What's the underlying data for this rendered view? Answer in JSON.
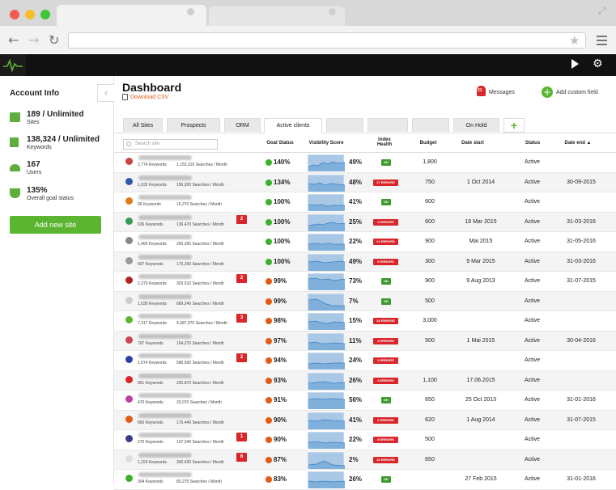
{
  "colors": {
    "accent_green": "#5cb531",
    "error_red": "#d8262a",
    "link_orange": "#e35b14",
    "ok_green": "#3c9a2c"
  },
  "sidebar": {
    "heading": "Account Info",
    "stats": [
      {
        "icon": "grid-icon",
        "value": "189 / Unlimited",
        "label": "Sites"
      },
      {
        "icon": "list-icon",
        "value": "138,324 / Unlimited",
        "label": "Keywords"
      },
      {
        "icon": "users-icon",
        "value": "167",
        "label": "Users"
      },
      {
        "icon": "trophy-icon",
        "value": "135%",
        "label": "Overall goal status"
      }
    ],
    "add_site_label": "Add new site"
  },
  "header": {
    "title": "Dashboard",
    "download_label": "Download CSV",
    "messages_label": "Messages",
    "messages_count": "21",
    "add_field_label": "Add custom field"
  },
  "tabs": [
    "All Sites",
    "Prospects",
    "ORM",
    "Active clients",
    "",
    "",
    "",
    "On Hold"
  ],
  "active_tab": 3,
  "search": {
    "placeholder": "Search site"
  },
  "columns": {
    "goal": "Goal Status",
    "visibility": "Visibility Score",
    "index": "Index Health",
    "budget": "Budget",
    "date_start": "Date start",
    "status": "Status",
    "date_end": "Date end ▲"
  },
  "rows": [
    {
      "kw": "2,774 Keywords",
      "searches": "1,153,310 Searches / Month",
      "note": "",
      "goal": "140%",
      "goal_color": "#3cb12b",
      "vis": "49%",
      "index": "OK",
      "budget": "1,800",
      "date_start": "",
      "status": "Active",
      "date_end": "",
      "fav": "#c44"
    },
    {
      "kw": "1,032 Keywords",
      "searches": "156,200 Searches / Month",
      "note": "",
      "goal": "134%",
      "goal_color": "#3cb12b",
      "vis": "48%",
      "index": "17 ERRORS",
      "budget": "750",
      "date_start": "1 Oct 2014",
      "status": "Active",
      "date_end": "30-09-2015",
      "fav": "#2d5aa8"
    },
    {
      "kw": "96 Keywords",
      "searches": "15,270 Searches / Month",
      "note": "",
      "goal": "100%",
      "goal_color": "#3cb12b",
      "vis": "41%",
      "index": "OK",
      "budget": "600",
      "date_start": "",
      "status": "Active",
      "date_end": "",
      "fav": "#e07a1a"
    },
    {
      "kw": "636 Keywords",
      "searches": "136,470 Searches / Month",
      "note": "2",
      "goal": "100%",
      "goal_color": "#3cb12b",
      "vis": "25%",
      "index": "3 ERRORS",
      "budget": "600",
      "date_start": "18 Mar 2015",
      "status": "Active",
      "date_end": "31-03-2016",
      "fav": "#3a9a56"
    },
    {
      "kw": "1,466 Keywords",
      "searches": "266,260 Searches / Month",
      "note": "",
      "goal": "100%",
      "goal_color": "#3cb12b",
      "vis": "22%",
      "index": "14 ERRORS",
      "budget": "900",
      "date_start": "Mai 2015",
      "status": "Active",
      "date_end": "31-05-2016",
      "fav": "#888"
    },
    {
      "kw": "607 Keywords",
      "searches": "176,260 Searches / Month",
      "note": "",
      "goal": "100%",
      "goal_color": "#3cb12b",
      "vis": "49%",
      "index": "5 ERRORS",
      "budget": "300",
      "date_start": "9 Mar 2015",
      "status": "Active",
      "date_end": "31-03-2016",
      "fav": "#999"
    },
    {
      "kw": "2,379 Keywords",
      "searches": "303,510 Searches / Month",
      "note": "2",
      "goal": "99%",
      "goal_color": "#e35b14",
      "vis": "73%",
      "index": "OK",
      "budget": "900",
      "date_start": "9 Aug 2013",
      "status": "Active",
      "date_end": "31-07-2015",
      "fav": "#b32222"
    },
    {
      "kw": "1,030 Keywords",
      "searches": "689,240 Searches / Month",
      "note": "",
      "goal": "99%",
      "goal_color": "#e35b14",
      "vis": "7%",
      "index": "OK",
      "budget": "500",
      "date_start": "",
      "status": "Active",
      "date_end": "",
      "fav": "#ccc"
    },
    {
      "kw": "7,317 Keywords",
      "searches": "4,387,070 Searches / Month",
      "note": "3",
      "goal": "98%",
      "goal_color": "#e35b14",
      "vis": "15%",
      "index": "34 ERRORS",
      "budget": "3,000",
      "date_start": "",
      "status": "Active",
      "date_end": "",
      "fav": "#5cb531"
    },
    {
      "kw": "797 Keywords",
      "searches": "164,270 Searches / Month",
      "note": "",
      "goal": "97%",
      "goal_color": "#e35b14",
      "vis": "11%",
      "index": "4 ERRORS",
      "budget": "500",
      "date_start": "1 Mai 2015",
      "status": "Active",
      "date_end": "30-04-2016",
      "fav": "#c45"
    },
    {
      "kw": "1,074 Keywords",
      "searches": "586,500 Searches / Month",
      "note": "2",
      "goal": "94%",
      "goal_color": "#e35b14",
      "vis": "24%",
      "index": "2 ERRORS",
      "budget": "",
      "date_start": "",
      "status": "Active",
      "date_end": "",
      "fav": "#2b3fa8"
    },
    {
      "kw": "891 Keywords",
      "searches": "205,870 Searches / Month",
      "note": "",
      "goal": "93%",
      "goal_color": "#e35b14",
      "vis": "26%",
      "index": "3 ERRORS",
      "budget": "1,100",
      "date_start": "17.06.2015",
      "status": "Active",
      "date_end": "",
      "fav": "#d8262a"
    },
    {
      "kw": "470 Keywords",
      "searches": "20,070 Searches / Month",
      "note": "",
      "goal": "91%",
      "goal_color": "#e35b14",
      "vis": "56%",
      "index": "OK",
      "budget": "650",
      "date_start": "25 Oct 2013",
      "status": "Active",
      "date_end": "31-01-2016",
      "fav": "#c03fa0"
    },
    {
      "kw": "860 Keywords",
      "searches": "176,440 Searches / Month",
      "note": "",
      "goal": "90%",
      "goal_color": "#e35b14",
      "vis": "41%",
      "index": "6 ERRORS",
      "budget": "620",
      "date_start": "1 Aug 2014",
      "status": "Active",
      "date_end": "31-07-2015",
      "fav": "#e35b14"
    },
    {
      "kw": "270 Keywords",
      "searches": "107,240 Searches / Month",
      "note": "1",
      "goal": "90%",
      "goal_color": "#e35b14",
      "vis": "22%",
      "index": "5 ERRORS",
      "budget": "500",
      "date_start": "",
      "status": "Active",
      "date_end": "",
      "fav": "#3a3a8a"
    },
    {
      "kw": "1,153 Keywords",
      "searches": "342,430 Searches / Month",
      "note": "6",
      "goal": "87%",
      "goal_color": "#e35b14",
      "vis": "2%",
      "index": "12 ERRORS",
      "budget": "650",
      "date_start": "",
      "status": "Active",
      "date_end": "",
      "fav": "#ddd"
    },
    {
      "kw": "304 Keywords",
      "searches": "80,270 Searches / Month",
      "note": "",
      "goal": "83%",
      "goal_color": "#e35b14",
      "vis": "26%",
      "index": "OK",
      "budget": "",
      "date_start": "27 Feb 2015",
      "status": "Active",
      "date_end": "31-01-2016",
      "fav": "#3cb12b"
    }
  ]
}
